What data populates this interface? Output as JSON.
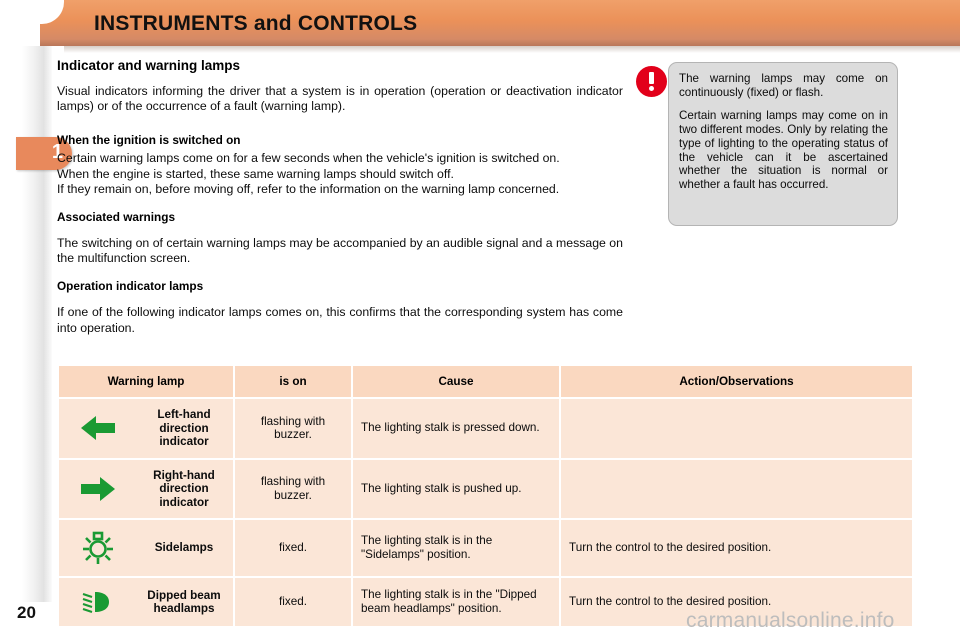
{
  "banner": {
    "title": "INSTRUMENTS and CONTROLS"
  },
  "sidebar": {
    "chapter_number": "1",
    "page_number": "20"
  },
  "content": {
    "heading": "Indicator and warning lamps",
    "intro": "Visual indicators informing the driver that a system is in operation (operation or deactivation indicator lamps) or of the occurrence of a fault (warning lamp).",
    "sections": [
      {
        "heading": "When the ignition is switched on",
        "paragraphs": [
          "Certain warning lamps come on for a few seconds when the vehicle's ignition is switched on.",
          "When the engine is started, these same warning lamps should switch off.",
          "If they remain on, before moving off, refer to the information on the warning lamp concerned."
        ]
      },
      {
        "heading": "Associated warnings",
        "paragraphs": [
          "The switching on of certain warning lamps may be accompanied by an audible signal and a message on the multifunction screen."
        ]
      },
      {
        "heading": "Operation indicator lamps",
        "paragraphs": [
          "If one of the following indicator lamps comes on, this confirms that the corresponding system has come into operation."
        ]
      }
    ]
  },
  "callout": {
    "icon": "warning-exclamation-icon",
    "icon_color": "#e2001a",
    "paragraphs": [
      "The warning lamps may come on continuously (fixed) or flash.",
      "Certain warning lamps may come on in two different modes. Only by relating the type of lighting to the operating status of the vehicle can it be ascertained whether the situation is normal or whether a fault has occurred."
    ]
  },
  "table": {
    "headers": {
      "warning_lamp": "Warning lamp",
      "is_on": "is on",
      "cause": "Cause",
      "action": "Action/Observations"
    },
    "icon_color": "#1a9a33",
    "rows": [
      {
        "icon": "arrow-left-icon",
        "lamp": "Left-hand direction indicator",
        "is_on": "flashing with buzzer.",
        "cause": "The lighting stalk is pressed down.",
        "action": ""
      },
      {
        "icon": "arrow-right-icon",
        "lamp": "Right-hand direction indicator",
        "is_on": "flashing with buzzer.",
        "cause": "The lighting stalk is pushed up.",
        "action": ""
      },
      {
        "icon": "sidelamp-icon",
        "lamp": "Sidelamps",
        "is_on": "fixed.",
        "cause": "The lighting stalk is in the \"Sidelamps\" position.",
        "action": "Turn the control to the desired position."
      },
      {
        "icon": "dipped-beam-headlamp-icon",
        "lamp": "Dipped beam headlamps",
        "is_on": "fixed.",
        "cause": "The lighting stalk is in the \"Dipped beam headlamps\" position.",
        "action": "Turn the control to the desired position."
      }
    ]
  },
  "watermark": {
    "text": "carmanualsonline.info"
  }
}
